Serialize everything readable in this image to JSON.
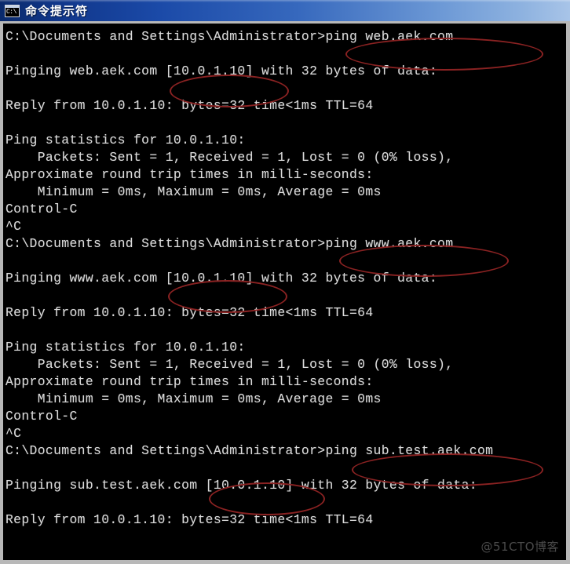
{
  "window": {
    "title": "命令提示符",
    "icon_label": "C:\\",
    "icon_name": "command-prompt-icon"
  },
  "colors": {
    "titlebar_start": "#0a2a6b",
    "titlebar_end": "#a8c4e8",
    "console_background": "#000000",
    "console_text": "#dcdcdc",
    "annotation_red": "#8a2222",
    "watermark": "#4a4a4a"
  },
  "console": {
    "lines": [
      "C:\\Documents and Settings\\Administrator>ping web.aek.com",
      "",
      "Pinging web.aek.com [10.0.1.10] with 32 bytes of data:",
      "",
      "Reply from 10.0.1.10: bytes=32 time<1ms TTL=64",
      "",
      "Ping statistics for 10.0.1.10:",
      "    Packets: Sent = 1, Received = 1, Lost = 0 (0% loss),",
      "Approximate round trip times in milli-seconds:",
      "    Minimum = 0ms, Maximum = 0ms, Average = 0ms",
      "Control-C",
      "^C",
      "C:\\Documents and Settings\\Administrator>ping www.aek.com",
      "",
      "Pinging www.aek.com [10.0.1.10] with 32 bytes of data:",
      "",
      "Reply from 10.0.1.10: bytes=32 time<1ms TTL=64",
      "",
      "Ping statistics for 10.0.1.10:",
      "    Packets: Sent = 1, Received = 1, Lost = 0 (0% loss),",
      "Approximate round trip times in milli-seconds:",
      "    Minimum = 0ms, Maximum = 0ms, Average = 0ms",
      "Control-C",
      "^C",
      "C:\\Documents and Settings\\Administrator>ping sub.test.aek.com",
      "",
      "Pinging sub.test.aek.com [10.0.1.10] with 32 bytes of data:",
      "",
      "Reply from 10.0.1.10: bytes=32 time<1ms TTL=64"
    ],
    "text": "C:\\Documents and Settings\\Administrator>ping web.aek.com\n\nPinging web.aek.com [10.0.1.10] with 32 bytes of data:\n\nReply from 10.0.1.10: bytes=32 time<1ms TTL=64\n\nPing statistics for 10.0.1.10:\n    Packets: Sent = 1, Received = 1, Lost = 0 (0% loss),\nApproximate round trip times in milli-seconds:\n    Minimum = 0ms, Maximum = 0ms, Average = 0ms\nControl-C\n^C\nC:\\Documents and Settings\\Administrator>ping www.aek.com\n\nPinging www.aek.com [10.0.1.10] with 32 bytes of data:\n\nReply from 10.0.1.10: bytes=32 time<1ms TTL=64\n\nPing statistics for 10.0.1.10:\n    Packets: Sent = 1, Received = 1, Lost = 0 (0% loss),\nApproximate round trip times in milli-seconds:\n    Minimum = 0ms, Maximum = 0ms, Average = 0ms\nControl-C\n^C\nC:\\Documents and Settings\\Administrator>ping sub.test.aek.com\n\nPinging sub.test.aek.com [10.0.1.10] with 32 bytes of data:\n\nReply from 10.0.1.10: bytes=32 time<1ms TTL=64"
  },
  "annotations": [
    {
      "id": "highlight-command-1",
      "target": "ping web.aek.com"
    },
    {
      "id": "highlight-address-1",
      "target": "[10.0.1.10]"
    },
    {
      "id": "highlight-command-2",
      "target": "ping www.aek.com"
    },
    {
      "id": "highlight-address-2",
      "target": "[10.0.1.10]"
    },
    {
      "id": "highlight-command-3",
      "target": "ping sub.test.aek.com"
    },
    {
      "id": "highlight-address-3",
      "target": "[10.0.1.10]"
    }
  ],
  "watermark": {
    "text": "@51CTO博客"
  }
}
